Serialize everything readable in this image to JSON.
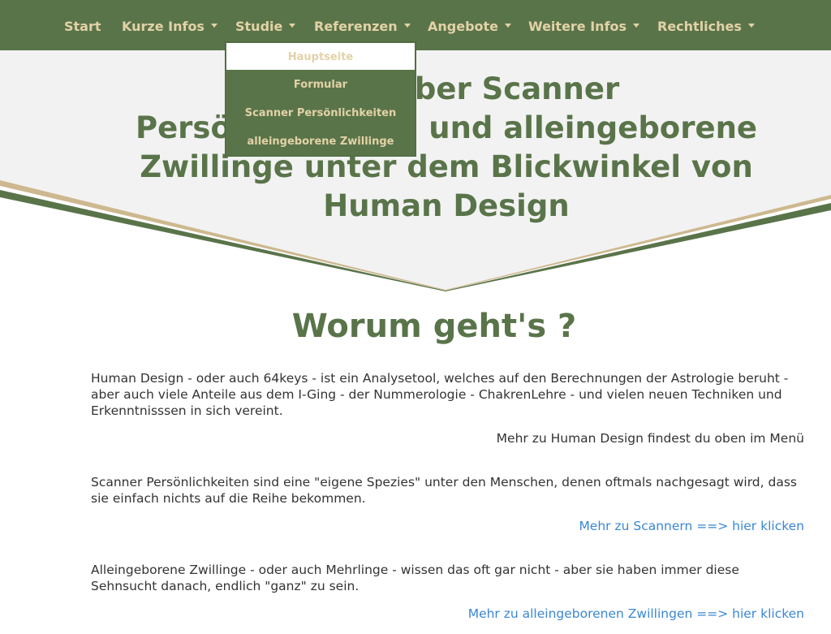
{
  "nav": {
    "items": [
      {
        "label": "Start",
        "has_dropdown": false
      },
      {
        "label": "Kurze Infos",
        "has_dropdown": true
      },
      {
        "label": "Studie",
        "has_dropdown": true
      },
      {
        "label": "Referenzen",
        "has_dropdown": true
      },
      {
        "label": "Angebote",
        "has_dropdown": true
      },
      {
        "label": "Weitere Infos",
        "has_dropdown": true
      },
      {
        "label": "Rechtliches",
        "has_dropdown": true
      }
    ]
  },
  "dropdown": {
    "items": [
      {
        "label": "Hauptseite",
        "active": true
      },
      {
        "label": "Formular",
        "active": false
      },
      {
        "label": "Scanner Persönlichkeiten",
        "active": false
      },
      {
        "label": "alleingeborene Zwillinge",
        "active": false
      }
    ]
  },
  "hero": {
    "title": "Studie über Scanner Persönlichkeiten und alleingeborene Zwillinge unter dem Blickwinkel von Human Design"
  },
  "main": {
    "heading": "Worum geht's ?",
    "sections": [
      {
        "text": "Human Design - oder auch 64keys - ist ein Analysetool, welches auf den Berechnungen der Astrologie beruht - aber auch viele Anteile aus dem I-Ging - der Nummerologie - ChakrenLehre - und vielen neuen Techniken und Erkenntnisssen in sich vereint.",
        "more": "Mehr zu Human Design findest du oben im Menü"
      },
      {
        "text": "Scanner Persönlichkeiten sind eine \"eigene Spezies\" unter den Menschen, denen oftmals nachgesagt wird, dass sie einfach nichts auf die Reihe bekommen.",
        "more": "Mehr zu Scannern ==> hier klicken"
      },
      {
        "text": "Alleingeborene Zwillinge - oder auch Mehrlinge - wissen das oft gar nicht - aber sie haben immer diese Sehnsucht danach, endlich \"ganz\" zu sein.",
        "more": "Mehr zu alleingeborenen Zwillingen ==> hier klicken"
      }
    ]
  },
  "colors": {
    "primary_green": "#5a744a",
    "gold": "#e3d2a6",
    "tan_stripe": "#cdb88f",
    "hero_background": "#f2f2f2",
    "link_blue": "#3a87d6",
    "text": "#333333"
  }
}
